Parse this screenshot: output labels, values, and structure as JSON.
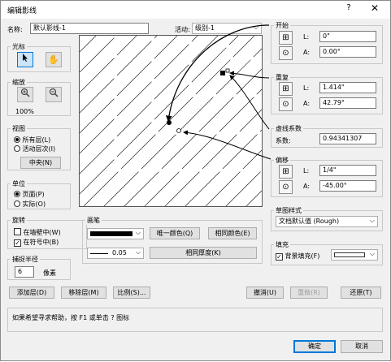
{
  "window": {
    "title": "编辑影线",
    "help": "?",
    "close": "✕"
  },
  "name": {
    "label": "名称:",
    "value": "默认影线-1"
  },
  "level": {
    "label": "活动:",
    "value": "级别-1"
  },
  "cursor_group": {
    "title": "光标",
    "arrow_icon": "arrow-cursor-icon",
    "hand_icon": "hand-icon"
  },
  "zoom_group": {
    "title": "缩放",
    "zoom_in_icon": "zoom-in-icon",
    "zoom_out_icon": "zoom-out-icon",
    "percent": "100%"
  },
  "view_group": {
    "title": "视图",
    "options": [
      "所有层(L)",
      "活动层次(I)"
    ],
    "selected": 0,
    "center_button": "中央(N)"
  },
  "units_group": {
    "title": "单位",
    "options": [
      "页面(P)",
      "实际(O)"
    ],
    "selected": 0
  },
  "rotate_group": {
    "title": "旋转",
    "options": [
      "在墙壁中(W)",
      "在符号中(B)"
    ],
    "checked": [
      false,
      true
    ]
  },
  "snap_group": {
    "title": "捕捉半径",
    "value": "6",
    "unit": "像素"
  },
  "origin": {
    "title": "开始",
    "l_label": "L:",
    "l_value": "0\"",
    "a_label": "A:",
    "a_value": "0.00°"
  },
  "repeat": {
    "title": "重复",
    "l_label": "L:",
    "l_value": "1.414\"",
    "a_label": "A:",
    "a_value": "42.79°"
  },
  "dash": {
    "title": "虚线系数",
    "label": "系数:",
    "value": "0.94341307"
  },
  "offset": {
    "title": "偏移",
    "l_label": "L:",
    "l_value": "1/4\"",
    "a_label": "A:",
    "a_value": "-45.00°"
  },
  "sketch": {
    "title": "草图样式",
    "value": "文档默认值 (Rough)"
  },
  "fill": {
    "title": "填充",
    "background_fill": "背景填充(F)",
    "checked": true
  },
  "pen": {
    "title": "画笔",
    "thickness": "0.05",
    "unique_color": "唯一颜色(Q)",
    "same_color": "相同颜色(E)",
    "same_thickness": "相同厚度(K)"
  },
  "bottom_buttons": {
    "add_layer": "添加层(D)",
    "remove_layer": "移除层(M)",
    "scale": "比例(S)...",
    "undo": "撤消(U)",
    "redo": "重做(R)",
    "revert": "还原(T)"
  },
  "status": {
    "text": "如果希望寻求帮助，按 F1 或单击 ? 图标"
  },
  "footer": {
    "ok": "确定",
    "cancel": "取消"
  }
}
